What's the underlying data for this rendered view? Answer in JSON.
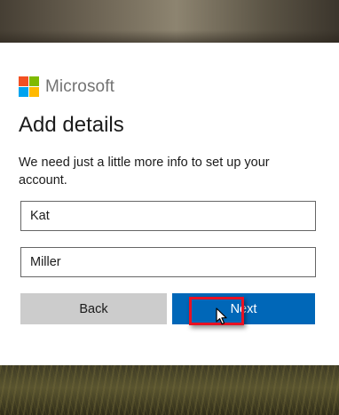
{
  "brand": {
    "name": "Microsoft",
    "logo_colors": [
      "#f25022",
      "#7fba00",
      "#00a4ef",
      "#ffb900"
    ]
  },
  "form": {
    "title": "Add details",
    "description": "We need just a little more info to set up your account.",
    "first_name_value": "Kat",
    "last_name_value": "Miller"
  },
  "buttons": {
    "back_label": "Back",
    "next_label": "Next"
  },
  "colors": {
    "primary": "#0067b8",
    "secondary": "#cccccc",
    "highlight": "#e81123"
  }
}
